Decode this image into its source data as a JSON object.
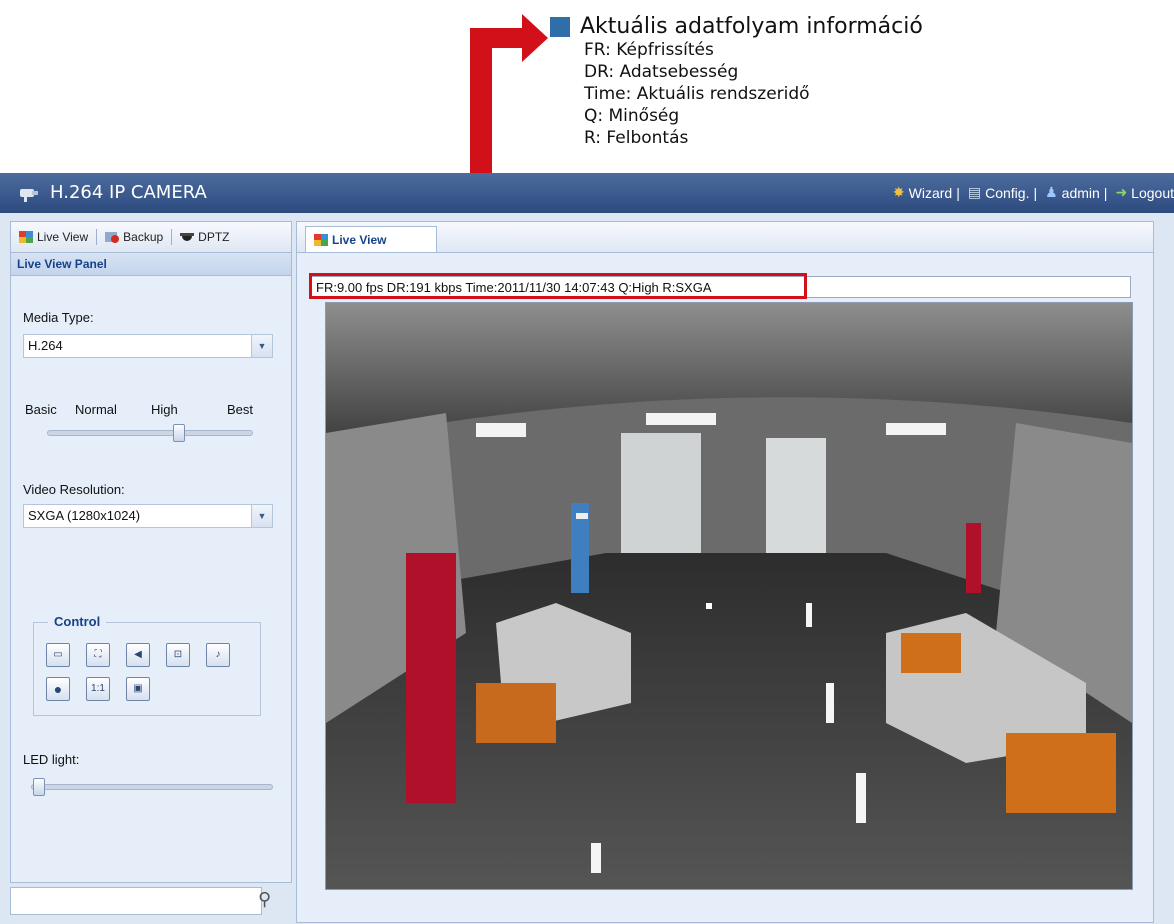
{
  "annotation": {
    "title": "Aktuális adatfolyam információ",
    "items": [
      "FR: Képfrissítés",
      "DR: Adatsebesség",
      "Time: Aktuális rendszeridő",
      "Q: Minőség",
      "R: Felbontás"
    ],
    "accent_color": "#d2101a",
    "marker_color": "#2f6ea8"
  },
  "app": {
    "title": "H.264 IP CAMERA",
    "nav": {
      "wizard": "Wizard",
      "config": "Config.",
      "admin": "admin",
      "logout": "Logout",
      "separator": "|"
    }
  },
  "left": {
    "tabs": [
      "Live View",
      "Backup",
      "DPTZ"
    ],
    "panel_title": "Live View Panel",
    "media_type": {
      "label": "Media Type:",
      "value": "H.264"
    },
    "quality": {
      "labels": [
        "Basic",
        "Normal",
        "High",
        "Best"
      ],
      "selected": "High"
    },
    "resolution": {
      "label": "Video Resolution:",
      "value": "SXGA (1280x1024)"
    },
    "control": {
      "legend": "Control"
    },
    "led": {
      "label": "LED light:",
      "level": 0
    },
    "search_placeholder": ""
  },
  "main": {
    "tab": "Live View",
    "info": "FR:9.00 fps  DR:191 kbps Time:2011/11/30 14:07:43 Q:High R:SXGA"
  }
}
